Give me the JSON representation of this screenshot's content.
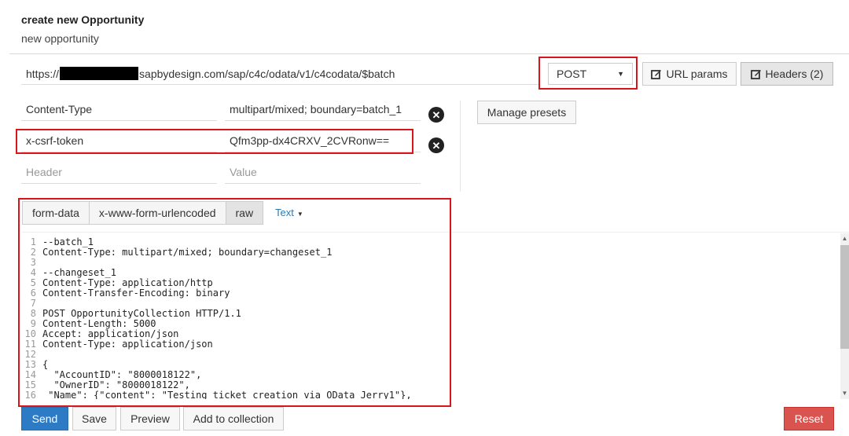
{
  "header": {
    "title": "create new Opportunity",
    "subtitle": "new opportunity"
  },
  "request": {
    "url_prefix": "https://",
    "url_suffix": "sapbydesign.com/sap/c4c/odata/v1/c4codata/$batch",
    "method": "POST"
  },
  "toolbar": {
    "url_params_label": "URL params",
    "headers_label": "Headers (2)"
  },
  "headers": {
    "rows": [
      {
        "key": "Content-Type",
        "value": "multipart/mixed; boundary=batch_1"
      },
      {
        "key": "x-csrf-token",
        "value": "Qfm3pp-dx4CRXV_2CVRonw=="
      }
    ],
    "key_placeholder": "Header",
    "value_placeholder": "Value",
    "manage_presets_label": "Manage presets"
  },
  "body_tabs": {
    "tabs": [
      "form-data",
      "x-www-form-urlencoded",
      "raw"
    ],
    "active": "raw",
    "text_type": "Text"
  },
  "editor": {
    "lines": [
      {
        "n": "1",
        "t": "--batch_1"
      },
      {
        "n": "2",
        "t": "Content-Type: multipart/mixed; boundary=changeset_1"
      },
      {
        "n": "3",
        "t": ""
      },
      {
        "n": "4",
        "t": "--changeset_1"
      },
      {
        "n": "5",
        "t": "Content-Type: application/http"
      },
      {
        "n": "6",
        "t": "Content-Transfer-Encoding: binary"
      },
      {
        "n": "7",
        "t": ""
      },
      {
        "n": "8",
        "t": "POST OpportunityCollection HTTP/1.1"
      },
      {
        "n": "9",
        "t": "Content-Length: 5000"
      },
      {
        "n": "10",
        "t": "Accept: application/json"
      },
      {
        "n": "11",
        "t": "Content-Type: application/json"
      },
      {
        "n": "12",
        "t": ""
      },
      {
        "n": "13",
        "t": "{"
      },
      {
        "n": "14",
        "t": "  \"AccountID\": \"8000018122\","
      },
      {
        "n": "15",
        "t": "  \"OwnerID\": \"8000018122\","
      },
      {
        "n": "16",
        "t": " \"Name\": {\"content\": \"Testing ticket creation via OData Jerry1\"},"
      }
    ]
  },
  "footer": {
    "send_label": "Send",
    "save_label": "Save",
    "preview_label": "Preview",
    "add_collection_label": "Add to collection",
    "reset_label": "Reset"
  },
  "colors": {
    "highlight": "#d9151c",
    "send": "#2d7bc4",
    "reset": "#d9534f"
  }
}
